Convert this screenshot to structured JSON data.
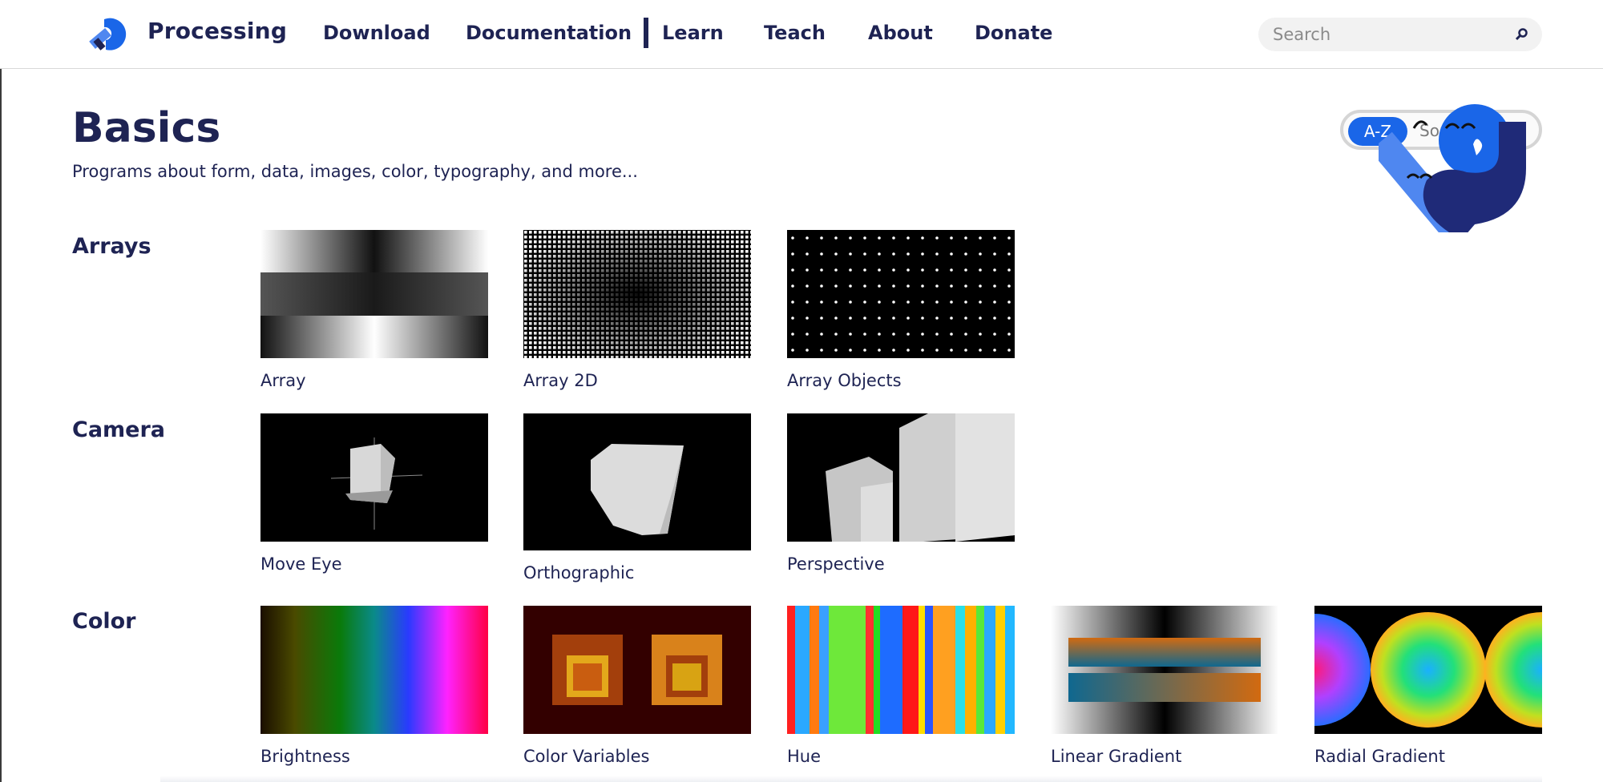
{
  "header": {
    "brand": "Processing",
    "nav": [
      {
        "label": "Download"
      },
      {
        "label": "Documentation"
      },
      {
        "label": "Learn"
      },
      {
        "label": "Teach"
      },
      {
        "label": "About"
      },
      {
        "label": "Donate"
      }
    ],
    "search": {
      "placeholder": "Search",
      "value": ""
    },
    "icons": {
      "logo": "processing-logo-icon",
      "search": "search-icon"
    }
  },
  "page": {
    "title": "Basics",
    "subtitle": "Programs about form, data, images, color, typography, and more...",
    "sort": {
      "active_label": "A-Z",
      "alt_label": "Sort"
    }
  },
  "categories": [
    {
      "title": "Arrays",
      "items": [
        {
          "label": "Array"
        },
        {
          "label": "Array 2D"
        },
        {
          "label": "Array Objects"
        }
      ]
    },
    {
      "title": "Camera",
      "items": [
        {
          "label": "Move Eye"
        },
        {
          "label": "Orthographic"
        },
        {
          "label": "Perspective"
        }
      ]
    },
    {
      "title": "Color",
      "items": [
        {
          "label": "Brightness"
        },
        {
          "label": "Color Variables"
        },
        {
          "label": "Hue"
        },
        {
          "label": "Linear Gradient"
        },
        {
          "label": "Radial Gradient"
        }
      ]
    }
  ],
  "colors": {
    "navy": "#1e2353",
    "accent_blue": "#1a66e8",
    "light_blue": "#4f87f0",
    "dark_blue": "#1f2a78"
  }
}
